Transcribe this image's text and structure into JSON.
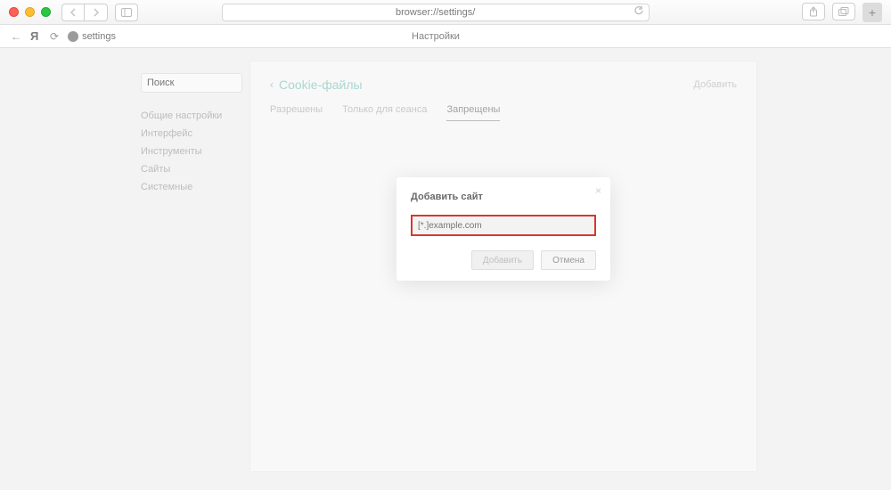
{
  "chrome": {
    "url": "browser://settings/",
    "tabs_plus": "+"
  },
  "browser_bar": {
    "back_icon": "←",
    "reload_icon": "⟳",
    "settings_label": "settings",
    "page_title": "Настройки"
  },
  "sidebar": {
    "search_placeholder": "Поиск",
    "items": [
      {
        "label": "Общие настройки"
      },
      {
        "label": "Интерфейс"
      },
      {
        "label": "Инструменты"
      },
      {
        "label": "Сайты"
      },
      {
        "label": "Системные"
      }
    ]
  },
  "main": {
    "back_label": "Cookie-файлы",
    "add_label": "Добавить",
    "tabs": [
      {
        "label": "Разрешены"
      },
      {
        "label": "Только для сеанса"
      },
      {
        "label": "Запрещены"
      }
    ],
    "active_tab_index": 2
  },
  "modal": {
    "title": "Добавить сайт",
    "input_placeholder": "[*.]example.com",
    "add_label": "Добавить",
    "cancel_label": "Отмена",
    "close_glyph": "×"
  },
  "colors": {
    "highlight_border": "#d43a2f"
  }
}
